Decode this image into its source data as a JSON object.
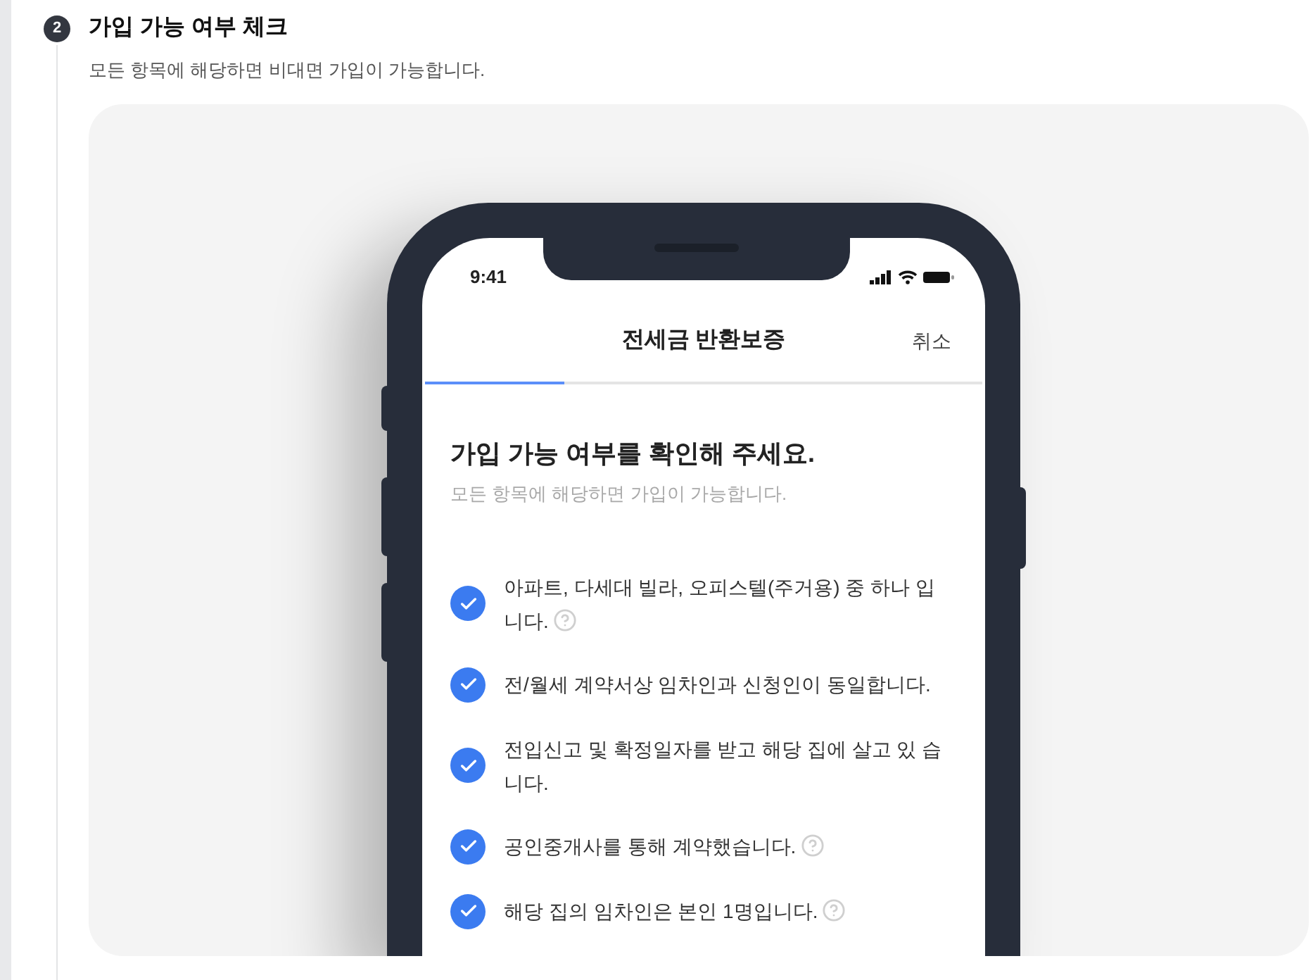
{
  "step": {
    "number": "2",
    "title": "가입 가능 여부 체크",
    "description": "모든 항목에 해당하면 비대면 가입이 가능합니다."
  },
  "phone": {
    "time": "9:41",
    "nav_title": "전세금 반환보증",
    "nav_action": "취소",
    "progress": {
      "level": 0.25
    },
    "heading": "가입 가능 여부를 확인해 주세요.",
    "subheading": "모든 항목에 해당하면 가입이 가능합니다.",
    "checklist": [
      {
        "text": "아파트, 다세대 빌라, 오피스텔(주거용) 중 하나 입니다.",
        "checked": true,
        "help": true
      },
      {
        "text": "전/월세 계약서상 임차인과 신청인이 동일합니다.",
        "checked": true,
        "help": false
      },
      {
        "text": "전입신고 및 확정일자를 받고 해당 집에 살고 있 습니다.",
        "checked": true,
        "help": false
      },
      {
        "text": "공인중개사를 통해 계약했습니다.",
        "checked": true,
        "help": true
      },
      {
        "text": "해당 집의 임차인은 본인 1명입니다.",
        "checked": true,
        "help": true
      }
    ]
  }
}
